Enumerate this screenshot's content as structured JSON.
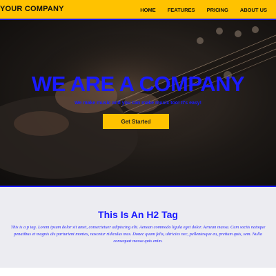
{
  "navbar": {
    "brand": "YOUR COMPANY",
    "links": [
      "HOME",
      "FEATURES",
      "PRICING",
      "ABOUT US"
    ]
  },
  "hero": {
    "title": "WE ARE A COMPANY",
    "subtitle": "We make music and you can make music too! It's easy!",
    "cta_label": "Get Started"
  },
  "content": {
    "heading": "This Is An H2 Tag",
    "paragraph": "This is a p tag. Lorem ipsum dolor sit amet, consectetuer adipiscing elit. Aenean commodo ligula eget dolor. Aenean massa. Cum sociis natoque penatibus et magnis dis parturient montes, nascetur ridiculus mus. Donec quam felis, ultricies nec, pellentesque eu, pretium quis, sem. Nulla consequat massa quis enim."
  },
  "colors": {
    "accent_yellow": "#ffc200",
    "accent_blue": "#1a1aff",
    "section_bg": "#ececf1"
  }
}
